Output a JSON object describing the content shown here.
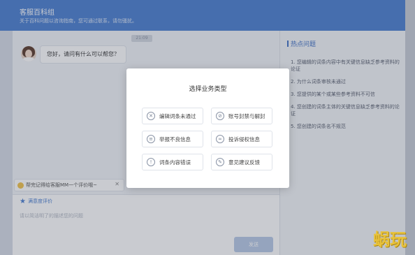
{
  "header": {
    "title": "客服百科组",
    "subtitle": "关于百科问题以咨询指南，您可通过联系，请勿骚扰。"
  },
  "chat": {
    "time_chip": "21:09",
    "greeting": "您好，请问有什么可以帮您？",
    "eval_prompt": "帮完记得给客服MM一个评价哦~",
    "eval_close": "✕",
    "rate_label": "满意度评价",
    "input_placeholder": "请以简洁明了的描述您的问题",
    "send_label": "发送"
  },
  "side_panel": {
    "title": "热点问题",
    "items": [
      "1. 您编辑的词条内容中有关键信息缺乏参考资料的论证",
      "2. 为什么词条审核未通过",
      "3. 您提供的某个或某些参考资料不可信",
      "4. 您创建的词条主体的关键信息缺乏参考资料的论证",
      "5. 您创建的词条名不规范"
    ]
  },
  "modal": {
    "title": "选择业务类型",
    "options": [
      {
        "label": "编辑词条未通过",
        "icon": "close-circle-icon",
        "glyph": "✕"
      },
      {
        "label": "账号封禁与解封",
        "icon": "ban-icon",
        "glyph": "⊘"
      },
      {
        "label": "举报不良信息",
        "icon": "report-icon",
        "glyph": "≡"
      },
      {
        "label": "投诉侵权信息",
        "icon": "link-icon",
        "glyph": "∞"
      },
      {
        "label": "词条内容错误",
        "icon": "info-circle-icon",
        "glyph": "!"
      },
      {
        "label": "意见建议反馈",
        "icon": "feedback-icon",
        "glyph": "✎"
      }
    ]
  },
  "watermark": "蜗玩"
}
